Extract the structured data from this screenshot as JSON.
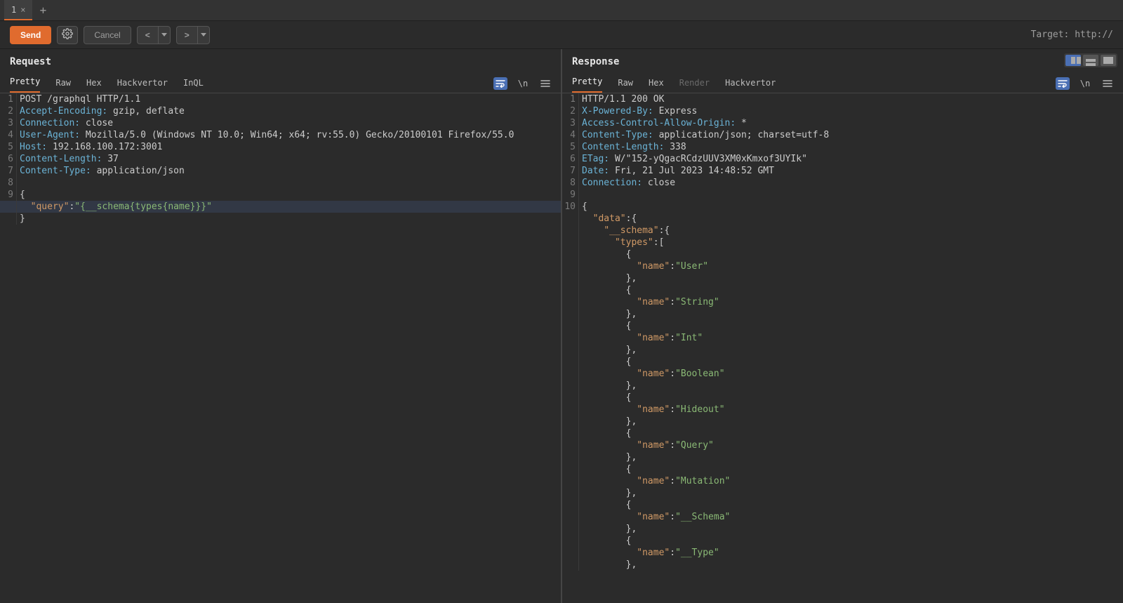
{
  "tabstrip": {
    "tabs": [
      {
        "label": "1"
      }
    ]
  },
  "toolbar": {
    "send": "Send",
    "cancel": "Cancel",
    "target_label": "Target: http://"
  },
  "request": {
    "title": "Request",
    "tabs": {
      "pretty": "Pretty",
      "raw": "Raw",
      "hex": "Hex",
      "hackvertor": "Hackvertor",
      "inql": "InQL"
    },
    "lines": [
      {
        "n": 1,
        "kind": "req-line",
        "tokens": [
          {
            "c": "t-plain",
            "t": "POST /graphql HTTP/1.1"
          }
        ]
      },
      {
        "n": 2,
        "kind": "header",
        "tokens": [
          {
            "c": "t-header",
            "t": "Accept-Encoding:"
          },
          {
            "c": "t-plain",
            "t": " gzip, deflate"
          }
        ]
      },
      {
        "n": 3,
        "kind": "header",
        "tokens": [
          {
            "c": "t-header",
            "t": "Connection:"
          },
          {
            "c": "t-plain",
            "t": " close"
          }
        ]
      },
      {
        "n": 4,
        "kind": "header",
        "tokens": [
          {
            "c": "t-header",
            "t": "User-Agent:"
          },
          {
            "c": "t-plain",
            "t": " Mozilla/5.0 (Windows NT 10.0; Win64; x64; rv:55.0) Gecko/20100101 Firefox/55.0"
          }
        ]
      },
      {
        "n": 5,
        "kind": "header",
        "tokens": [
          {
            "c": "t-header",
            "t": "Host:"
          },
          {
            "c": "t-plain",
            "t": " 192.168.100.172:3001"
          }
        ]
      },
      {
        "n": 6,
        "kind": "header",
        "tokens": [
          {
            "c": "t-header",
            "t": "Content-Length:"
          },
          {
            "c": "t-plain",
            "t": " 37"
          }
        ]
      },
      {
        "n": 7,
        "kind": "header",
        "tokens": [
          {
            "c": "t-header",
            "t": "Content-Type:"
          },
          {
            "c": "t-plain",
            "t": " application/json"
          }
        ]
      },
      {
        "n": 8,
        "kind": "blank",
        "tokens": [
          {
            "c": "t-plain",
            "t": ""
          }
        ]
      },
      {
        "n": 9,
        "kind": "json",
        "tokens": [
          {
            "c": "t-punc",
            "t": "{"
          }
        ]
      },
      {
        "n": "",
        "hl": true,
        "kind": "json",
        "tokens": [
          {
            "c": "t-plain",
            "t": "  "
          },
          {
            "c": "t-key",
            "t": "\"query\""
          },
          {
            "c": "t-punc",
            "t": ":"
          },
          {
            "c": "t-str",
            "t": "\"{__schema{types{name}}}\""
          }
        ]
      },
      {
        "n": "",
        "kind": "json",
        "tokens": [
          {
            "c": "t-punc",
            "t": "}"
          }
        ]
      }
    ]
  },
  "response": {
    "title": "Response",
    "tabs": {
      "pretty": "Pretty",
      "raw": "Raw",
      "hex": "Hex",
      "render": "Render",
      "hackvertor": "Hackvertor"
    },
    "lines": [
      {
        "n": 1,
        "tokens": [
          {
            "c": "t-plain",
            "t": "HTTP/1.1 200 OK"
          }
        ]
      },
      {
        "n": 2,
        "tokens": [
          {
            "c": "t-header",
            "t": "X-Powered-By:"
          },
          {
            "c": "t-plain",
            "t": " Express"
          }
        ]
      },
      {
        "n": 3,
        "tokens": [
          {
            "c": "t-header",
            "t": "Access-Control-Allow-Origin:"
          },
          {
            "c": "t-plain",
            "t": " *"
          }
        ]
      },
      {
        "n": 4,
        "tokens": [
          {
            "c": "t-header",
            "t": "Content-Type:"
          },
          {
            "c": "t-plain",
            "t": " application/json; charset=utf-8"
          }
        ]
      },
      {
        "n": 5,
        "tokens": [
          {
            "c": "t-header",
            "t": "Content-Length:"
          },
          {
            "c": "t-plain",
            "t": " 338"
          }
        ]
      },
      {
        "n": 6,
        "tokens": [
          {
            "c": "t-header",
            "t": "ETag:"
          },
          {
            "c": "t-plain",
            "t": " W/\"152-yQgacRCdzUUV3XM0xKmxof3UYIk\""
          }
        ]
      },
      {
        "n": 7,
        "tokens": [
          {
            "c": "t-header",
            "t": "Date:"
          },
          {
            "c": "t-plain",
            "t": " Fri, 21 Jul 2023 14:48:52 GMT"
          }
        ]
      },
      {
        "n": 8,
        "tokens": [
          {
            "c": "t-header",
            "t": "Connection:"
          },
          {
            "c": "t-plain",
            "t": " close"
          }
        ]
      },
      {
        "n": 9,
        "tokens": [
          {
            "c": "t-plain",
            "t": ""
          }
        ]
      },
      {
        "n": 10,
        "tokens": [
          {
            "c": "t-punc",
            "t": "{"
          }
        ]
      },
      {
        "n": "",
        "tokens": [
          {
            "c": "t-plain",
            "t": "  "
          },
          {
            "c": "t-key",
            "t": "\"data\""
          },
          {
            "c": "t-punc",
            "t": ":{"
          }
        ]
      },
      {
        "n": "",
        "tokens": [
          {
            "c": "t-plain",
            "t": "    "
          },
          {
            "c": "t-key",
            "t": "\"__schema\""
          },
          {
            "c": "t-punc",
            "t": ":{"
          }
        ]
      },
      {
        "n": "",
        "tokens": [
          {
            "c": "t-plain",
            "t": "      "
          },
          {
            "c": "t-key",
            "t": "\"types\""
          },
          {
            "c": "t-punc",
            "t": ":["
          }
        ]
      },
      {
        "n": "",
        "tokens": [
          {
            "c": "t-plain",
            "t": "        "
          },
          {
            "c": "t-punc",
            "t": "{"
          }
        ]
      },
      {
        "n": "",
        "tokens": [
          {
            "c": "t-plain",
            "t": "          "
          },
          {
            "c": "t-key",
            "t": "\"name\""
          },
          {
            "c": "t-punc",
            "t": ":"
          },
          {
            "c": "t-str",
            "t": "\"User\""
          }
        ]
      },
      {
        "n": "",
        "tokens": [
          {
            "c": "t-plain",
            "t": "        "
          },
          {
            "c": "t-punc",
            "t": "},"
          }
        ]
      },
      {
        "n": "",
        "tokens": [
          {
            "c": "t-plain",
            "t": "        "
          },
          {
            "c": "t-punc",
            "t": "{"
          }
        ]
      },
      {
        "n": "",
        "tokens": [
          {
            "c": "t-plain",
            "t": "          "
          },
          {
            "c": "t-key",
            "t": "\"name\""
          },
          {
            "c": "t-punc",
            "t": ":"
          },
          {
            "c": "t-str",
            "t": "\"String\""
          }
        ]
      },
      {
        "n": "",
        "tokens": [
          {
            "c": "t-plain",
            "t": "        "
          },
          {
            "c": "t-punc",
            "t": "},"
          }
        ]
      },
      {
        "n": "",
        "tokens": [
          {
            "c": "t-plain",
            "t": "        "
          },
          {
            "c": "t-punc",
            "t": "{"
          }
        ]
      },
      {
        "n": "",
        "tokens": [
          {
            "c": "t-plain",
            "t": "          "
          },
          {
            "c": "t-key",
            "t": "\"name\""
          },
          {
            "c": "t-punc",
            "t": ":"
          },
          {
            "c": "t-str",
            "t": "\"Int\""
          }
        ]
      },
      {
        "n": "",
        "tokens": [
          {
            "c": "t-plain",
            "t": "        "
          },
          {
            "c": "t-punc",
            "t": "},"
          }
        ]
      },
      {
        "n": "",
        "tokens": [
          {
            "c": "t-plain",
            "t": "        "
          },
          {
            "c": "t-punc",
            "t": "{"
          }
        ]
      },
      {
        "n": "",
        "tokens": [
          {
            "c": "t-plain",
            "t": "          "
          },
          {
            "c": "t-key",
            "t": "\"name\""
          },
          {
            "c": "t-punc",
            "t": ":"
          },
          {
            "c": "t-str",
            "t": "\"Boolean\""
          }
        ]
      },
      {
        "n": "",
        "tokens": [
          {
            "c": "t-plain",
            "t": "        "
          },
          {
            "c": "t-punc",
            "t": "},"
          }
        ]
      },
      {
        "n": "",
        "tokens": [
          {
            "c": "t-plain",
            "t": "        "
          },
          {
            "c": "t-punc",
            "t": "{"
          }
        ]
      },
      {
        "n": "",
        "tokens": [
          {
            "c": "t-plain",
            "t": "          "
          },
          {
            "c": "t-key",
            "t": "\"name\""
          },
          {
            "c": "t-punc",
            "t": ":"
          },
          {
            "c": "t-str",
            "t": "\"Hideout\""
          }
        ]
      },
      {
        "n": "",
        "tokens": [
          {
            "c": "t-plain",
            "t": "        "
          },
          {
            "c": "t-punc",
            "t": "},"
          }
        ]
      },
      {
        "n": "",
        "tokens": [
          {
            "c": "t-plain",
            "t": "        "
          },
          {
            "c": "t-punc",
            "t": "{"
          }
        ]
      },
      {
        "n": "",
        "tokens": [
          {
            "c": "t-plain",
            "t": "          "
          },
          {
            "c": "t-key",
            "t": "\"name\""
          },
          {
            "c": "t-punc",
            "t": ":"
          },
          {
            "c": "t-str",
            "t": "\"Query\""
          }
        ]
      },
      {
        "n": "",
        "tokens": [
          {
            "c": "t-plain",
            "t": "        "
          },
          {
            "c": "t-punc",
            "t": "},"
          }
        ]
      },
      {
        "n": "",
        "tokens": [
          {
            "c": "t-plain",
            "t": "        "
          },
          {
            "c": "t-punc",
            "t": "{"
          }
        ]
      },
      {
        "n": "",
        "tokens": [
          {
            "c": "t-plain",
            "t": "          "
          },
          {
            "c": "t-key",
            "t": "\"name\""
          },
          {
            "c": "t-punc",
            "t": ":"
          },
          {
            "c": "t-str",
            "t": "\"Mutation\""
          }
        ]
      },
      {
        "n": "",
        "tokens": [
          {
            "c": "t-plain",
            "t": "        "
          },
          {
            "c": "t-punc",
            "t": "},"
          }
        ]
      },
      {
        "n": "",
        "tokens": [
          {
            "c": "t-plain",
            "t": "        "
          },
          {
            "c": "t-punc",
            "t": "{"
          }
        ]
      },
      {
        "n": "",
        "tokens": [
          {
            "c": "t-plain",
            "t": "          "
          },
          {
            "c": "t-key",
            "t": "\"name\""
          },
          {
            "c": "t-punc",
            "t": ":"
          },
          {
            "c": "t-str",
            "t": "\"__Schema\""
          }
        ]
      },
      {
        "n": "",
        "tokens": [
          {
            "c": "t-plain",
            "t": "        "
          },
          {
            "c": "t-punc",
            "t": "},"
          }
        ]
      },
      {
        "n": "",
        "tokens": [
          {
            "c": "t-plain",
            "t": "        "
          },
          {
            "c": "t-punc",
            "t": "{"
          }
        ]
      },
      {
        "n": "",
        "tokens": [
          {
            "c": "t-plain",
            "t": "          "
          },
          {
            "c": "t-key",
            "t": "\"name\""
          },
          {
            "c": "t-punc",
            "t": ":"
          },
          {
            "c": "t-str",
            "t": "\"__Type\""
          }
        ]
      },
      {
        "n": "",
        "tokens": [
          {
            "c": "t-plain",
            "t": "        "
          },
          {
            "c": "t-punc",
            "t": "},"
          }
        ]
      }
    ]
  }
}
